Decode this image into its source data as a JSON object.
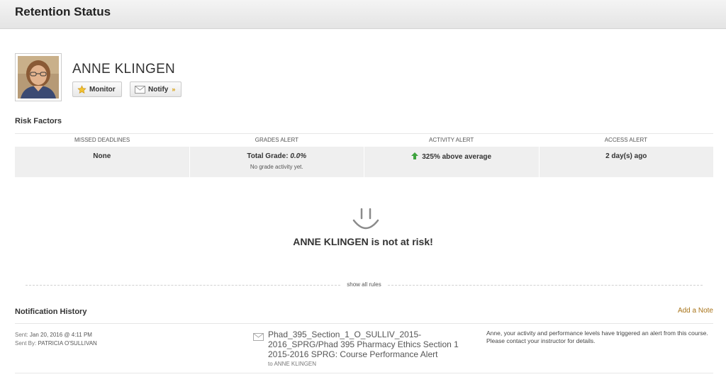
{
  "page": {
    "title": "Retention Status"
  },
  "student": {
    "name": "ANNE KLINGEN"
  },
  "actions": {
    "monitor_label": "Monitor",
    "notify_label": "Notify"
  },
  "risk": {
    "heading": "Risk Factors",
    "columns": [
      "MISSED DEADLINES",
      "GRADES ALERT",
      "ACTIVITY ALERT",
      "ACCESS ALERT"
    ],
    "missed_deadlines": "None",
    "grades_label": "Total Grade:",
    "grades_value": "0.0%",
    "grades_sub": "No grade activity yet.",
    "activity": "325% above average",
    "access": "2 day(s) ago"
  },
  "status": {
    "name": "ANNE KLINGEN",
    "message": "is not at risk!"
  },
  "rules": {
    "show_all": "show all rules"
  },
  "notifications": {
    "heading": "Notification History",
    "add_note": "Add a Note",
    "items": [
      {
        "sent_label": "Sent:",
        "sent": "Jan 20, 2016 @ 4:11 PM",
        "sent_by_label": "Sent By:",
        "sent_by": "PATRICIA O'SULLIVAN",
        "subject": "Phad_395_Section_1_O_SULLIV_2015-2016_SPRG/Phad 395 Pharmacy Ethics Section 1 2015-2016 SPRG: Course Performance Alert",
        "to": "to ANNE KLINGEN",
        "message": "Anne, your activity and performance levels have triggered an alert from this course. Please contact your instructor for details."
      }
    ]
  },
  "colors": {
    "accent_link": "#a8741a",
    "arrow_up": "#3ea33e",
    "smiley": "#8a8a8a"
  },
  "icons": {
    "monitor": "star-icon",
    "notify": "envelope-icon",
    "dropdown": "chevron-down-icon",
    "activity": "up-arrow-icon",
    "status": "smiley-icon"
  }
}
